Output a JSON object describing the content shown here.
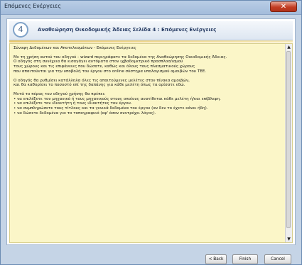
{
  "window": {
    "title": "Επόμενες Ενέργειες",
    "close_icon": "close-icon"
  },
  "header": {
    "step_number": "4",
    "title": "Αναθεώρηση Οικοδομικής Άδειας Σελίδα 4 : Επόμενες Ενέργειες"
  },
  "panel": {
    "heading": "Σύνοψη Δεδομένων και Αποτελεσμάτων - Επόμενες Ενέργειες",
    "para1": [
      "Με τη χρήση αυτού του οδηγού - wizard περιγράφατε τα δεδομένα της Αναθεώρησης Οικοδομικής Άδειας.",
      "Ο οδηγός στη συνέχεια θα εισαγάγει αυτόματα στον ιχβαδομετρικό προσπλοσ/ισμού",
      "τους χώρους και τις επιφάνειες που δώσατε, καθώς και όλους τους πλασματικούς χώρους",
      "που απαιτούνται για την υποβολή του έργου στο online σύστημα υπολογισμού αμοιβών του ΤΕΕ."
    ],
    "para2": [
      "Ο οδηγός θα ρυθμίσει κατάλληλα όλες τις απαιτούμενες μελέτες στον πίνακα αμοιβών,",
      "και θα καθορίσει το ποσοστό επί της δαπάνης για κάθε μελέτη όπως τα ορίσατε εδώ."
    ],
    "para3_intro": "Μετά το πέρας του οδηγού χρήσης θα πρέπει:",
    "bullets": [
      "• να επιλέξετε τον μηχανικό ή τους μηχανικούς στους οποίους ανατίθεται κάθε μελέτη ή/και επίβλεψη.",
      "• να επιλέξετε τον ιδιοκτήτη ή τους ιδιοκτήτες του έργου.",
      "• να συμπληρώσετε τους τίτλους και τα γενικά δεδομένα του έργου (αν δεν το έχετε κάνει ήδη).",
      "• να δώσετε δεδομένα για το τοπογραφικό (εφ' όσον συντρέχει λόγος)."
    ]
  },
  "buttons": {
    "back": "< Back",
    "finish": "Finish",
    "cancel": "Cancel"
  },
  "colors": {
    "panel_bg": "#fbf6c8",
    "title_bar": "#b9cde5",
    "close_button": "#c23c22"
  }
}
